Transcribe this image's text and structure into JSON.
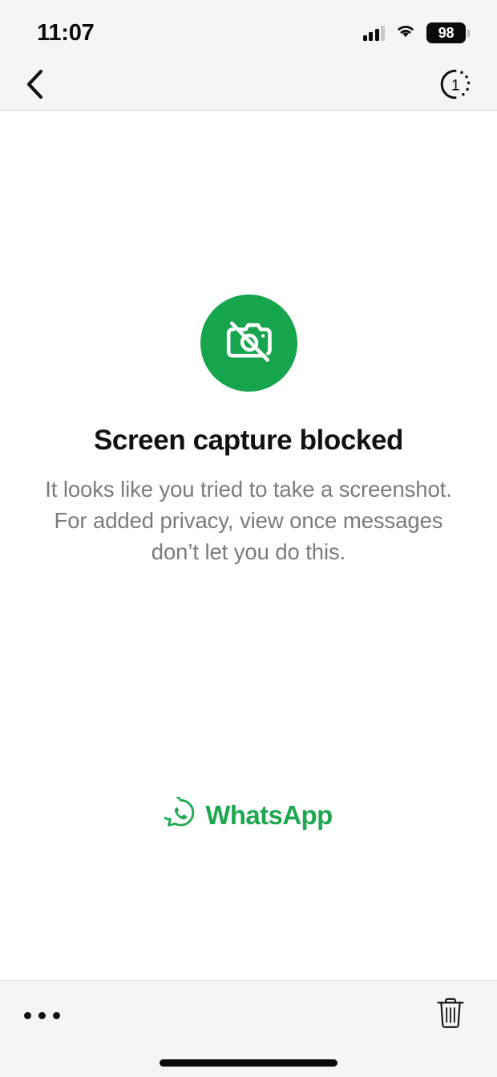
{
  "status_bar": {
    "time": "11:07",
    "signal_icon": "cellular-signal-icon",
    "wifi_icon": "wifi-icon",
    "battery_percent": "98",
    "battery_icon": "battery-icon"
  },
  "nav_bar": {
    "back_icon": "back-chevron-icon",
    "view_once_icon": "view-once-icon",
    "view_once_label": "1"
  },
  "main": {
    "hero_icon": "camera-blocked-icon",
    "headline": "Screen capture blocked",
    "body": "It looks like you tried to take a screenshot. For added privacy, view once messages don’t let you do this.",
    "brand_icon": "whatsapp-logo-icon",
    "brand_name": "WhatsApp"
  },
  "bottom_bar": {
    "more_icon": "more-dots-icon",
    "delete_icon": "trash-icon",
    "home_indicator": "home-indicator"
  },
  "colors": {
    "brand_green": "#1da851",
    "hero_green": "#16a44c",
    "headline": "#111111",
    "body_text": "#7b7b7b",
    "bar_background": "#f5f5f5",
    "divider": "#dcdcdc"
  }
}
